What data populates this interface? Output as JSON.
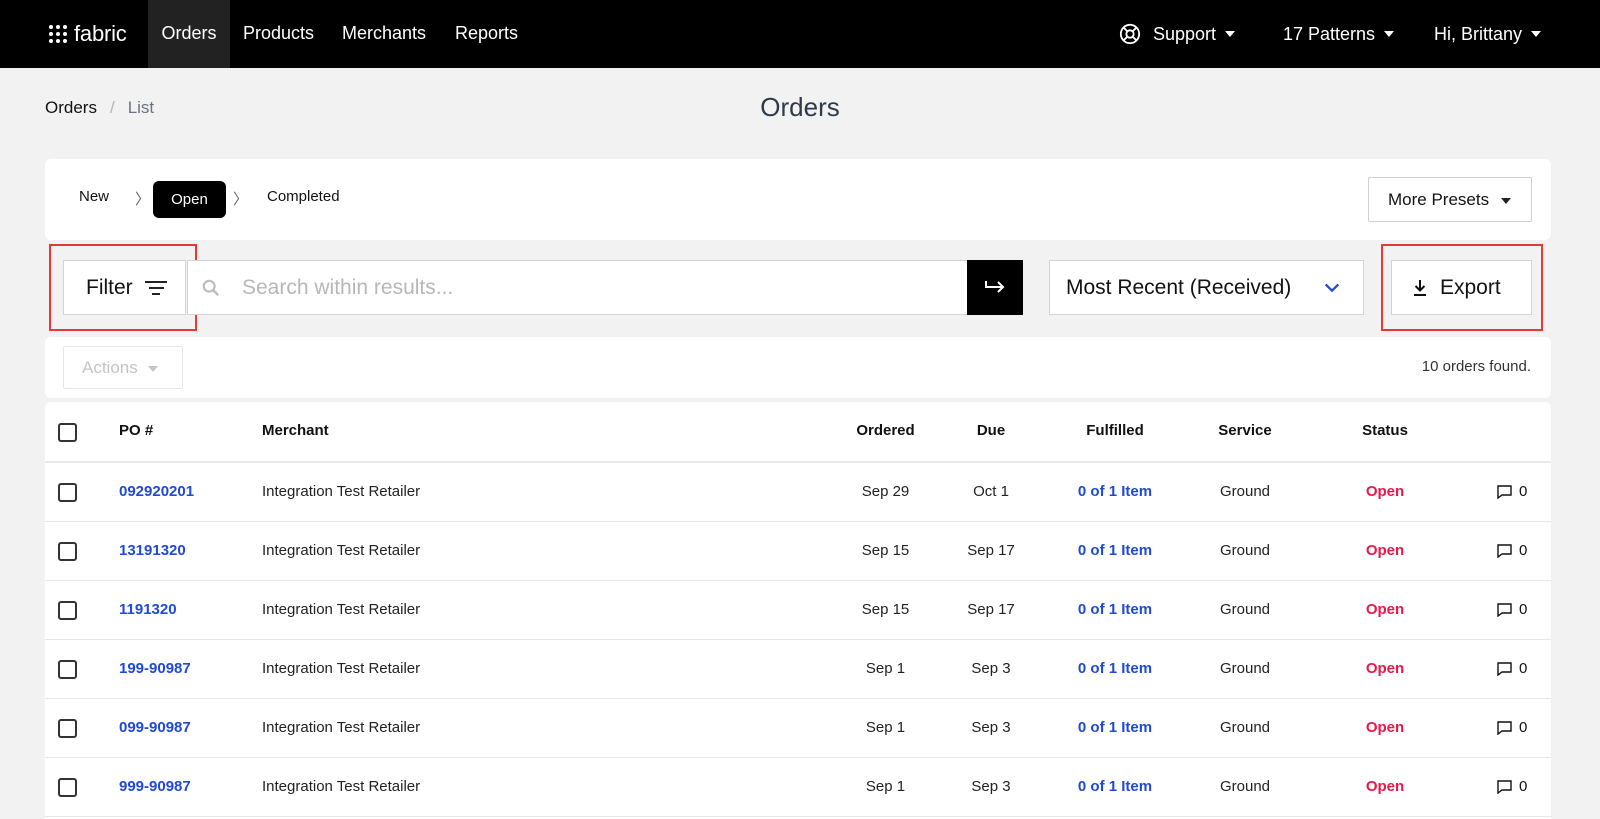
{
  "nav": {
    "logo": "fabric",
    "items": [
      "Orders",
      "Products",
      "Merchants",
      "Reports"
    ],
    "active": "Orders",
    "support": "Support",
    "patterns": "17 Patterns",
    "user": "Hi, Brittany"
  },
  "breadcrumb": {
    "root": "Orders",
    "separator": "/",
    "current": "List"
  },
  "page_title": "Orders",
  "presets": {
    "new": "New",
    "open": "Open",
    "completed": "Completed",
    "more": "More Presets"
  },
  "filter": {
    "label": "Filter"
  },
  "search": {
    "placeholder": "Search within results...",
    "value": ""
  },
  "sort": {
    "selected": "Most Recent (Received)"
  },
  "export": {
    "label": "Export"
  },
  "actions": {
    "label": "Actions"
  },
  "orders_count": "10 orders found.",
  "table": {
    "headers": {
      "po": "PO #",
      "merchant": "Merchant",
      "ordered": "Ordered",
      "due": "Due",
      "fulfilled": "Fulfilled",
      "service": "Service",
      "status": "Status"
    },
    "rows": [
      {
        "po": "092920201",
        "merchant": "Integration Test Retailer",
        "ordered": "Sep 29",
        "due": "Oct 1",
        "fulfilled": "0 of 1 Item",
        "service": "Ground",
        "status": "Open",
        "comments": "0"
      },
      {
        "po": "13191320",
        "merchant": "Integration Test Retailer",
        "ordered": "Sep 15",
        "due": "Sep 17",
        "fulfilled": "0 of 1 Item",
        "service": "Ground",
        "status": "Open",
        "comments": "0"
      },
      {
        "po": "1191320",
        "merchant": "Integration Test Retailer",
        "ordered": "Sep 15",
        "due": "Sep 17",
        "fulfilled": "0 of 1 Item",
        "service": "Ground",
        "status": "Open",
        "comments": "0"
      },
      {
        "po": "199-90987",
        "merchant": "Integration Test Retailer",
        "ordered": "Sep 1",
        "due": "Sep 3",
        "fulfilled": "0 of 1 Item",
        "service": "Ground",
        "status": "Open",
        "comments": "0"
      },
      {
        "po": "099-90987",
        "merchant": "Integration Test Retailer",
        "ordered": "Sep 1",
        "due": "Sep 3",
        "fulfilled": "0 of 1 Item",
        "service": "Ground",
        "status": "Open",
        "comments": "0"
      },
      {
        "po": "999-90987",
        "merchant": "Integration Test Retailer",
        "ordered": "Sep 1",
        "due": "Sep 3",
        "fulfilled": "0 of 1 Item",
        "service": "Ground",
        "status": "Open",
        "comments": "0"
      }
    ]
  },
  "colors": {
    "link_blue": "#1f4ad6",
    "status_open": "#e8194a",
    "highlight": "#e53935",
    "nav_bg": "#000000"
  }
}
